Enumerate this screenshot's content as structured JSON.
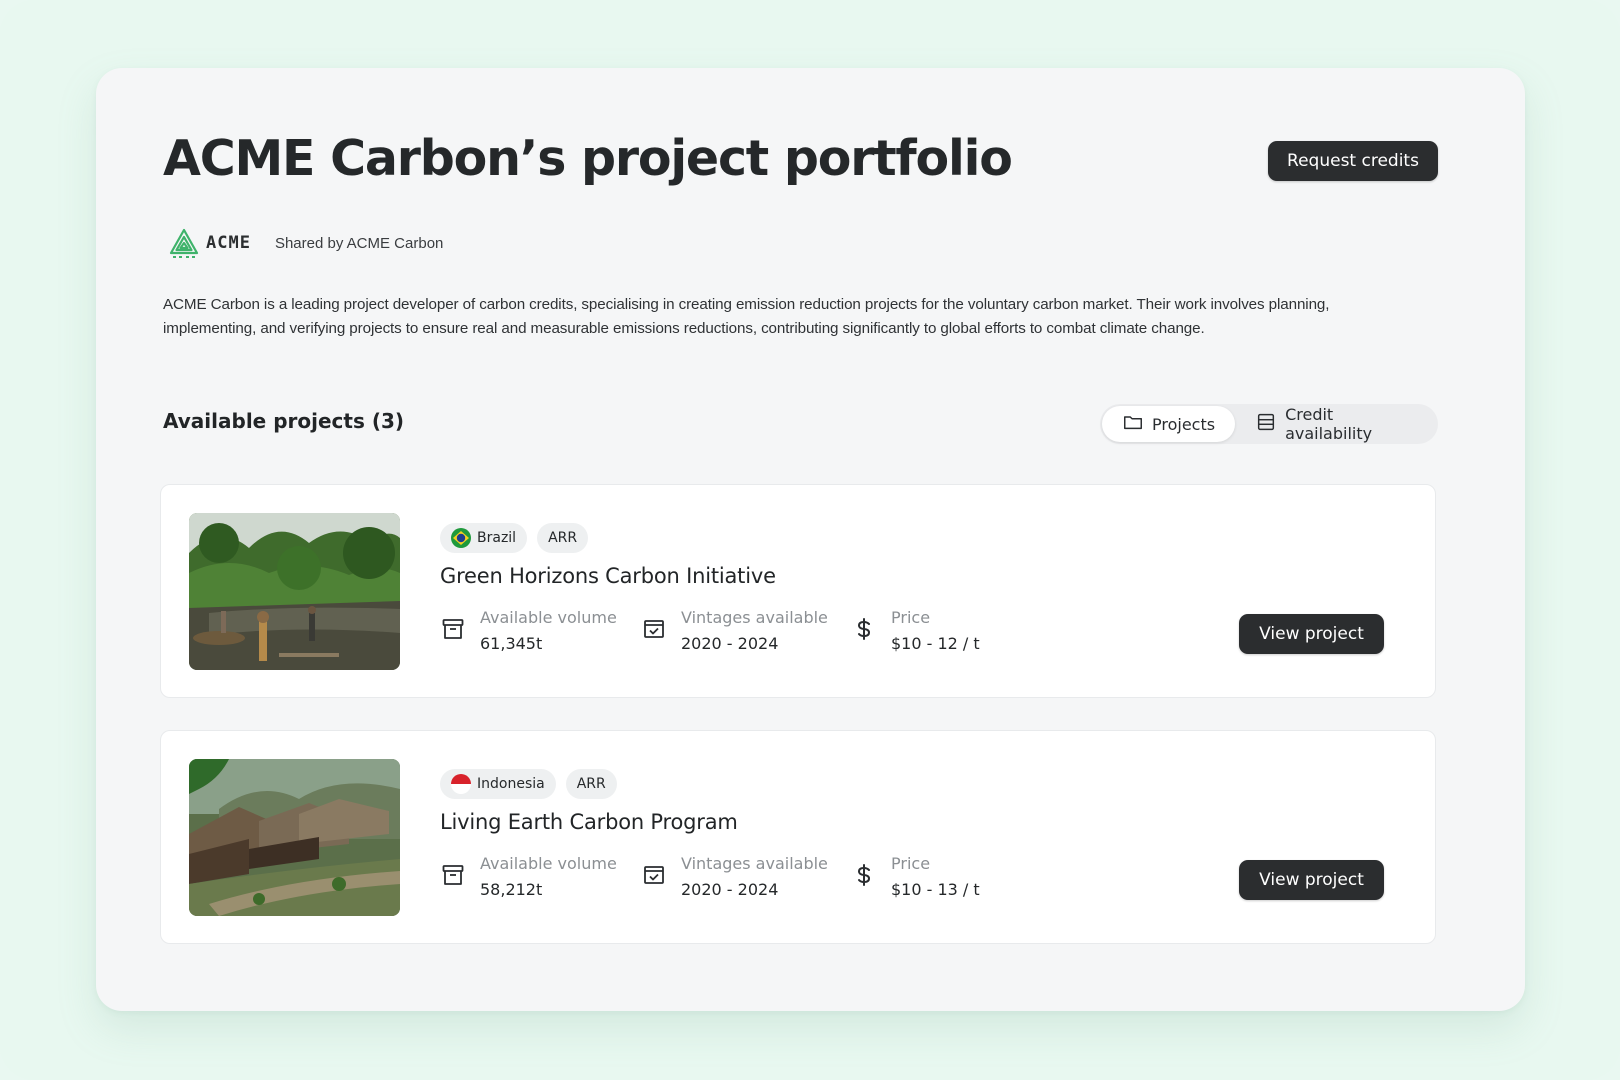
{
  "header": {
    "title": "ACME Carbon’s project portfolio",
    "request_button": "Request credits"
  },
  "company": {
    "logo_text": "ACME",
    "shared_by": "Shared by ACME Carbon",
    "brand_color": "#3fb36b"
  },
  "description": "ACME Carbon is a leading project developer of carbon credits, specialising in creating emission reduction projects for the voluntary carbon market.  Their work involves planning, implementing, and verifying projects to ensure real and measurable emissions reductions, contributing significantly to global efforts to combat climate change.",
  "projects_section": {
    "title": "Available projects (3)",
    "view_toggle": {
      "options": [
        {
          "label": "Projects",
          "icon": "folder-icon",
          "active": true
        },
        {
          "label": "Credit availability",
          "icon": "table-icon",
          "active": false
        }
      ]
    }
  },
  "projects": [
    {
      "country": "Brazil",
      "flag": "brazil-flag",
      "type": "ARR",
      "name": "Green Horizons Carbon Initiative",
      "volume_label": "Available volume",
      "volume": "61,345t",
      "vintages_label": "Vintages available",
      "vintages": "2020 - 2024",
      "price_label": "Price",
      "price": "$10 - 12 / t",
      "button": "View project",
      "image": "river-forest-photo"
    },
    {
      "country": "Indonesia",
      "flag": "indonesia-flag",
      "type": "ARR",
      "name": "Living Earth Carbon Program",
      "volume_label": "Available volume",
      "volume": "58,212t",
      "vintages_label": "Vintages available",
      "vintages": "2020 - 2024",
      "price_label": "Price",
      "price": "$10 - 13 / t",
      "button": "View project",
      "image": "village-huts-photo"
    }
  ],
  "colors": {
    "background": "#e8f8f0",
    "panel": "#f5f6f7",
    "button_dark": "#2b2d2f"
  }
}
